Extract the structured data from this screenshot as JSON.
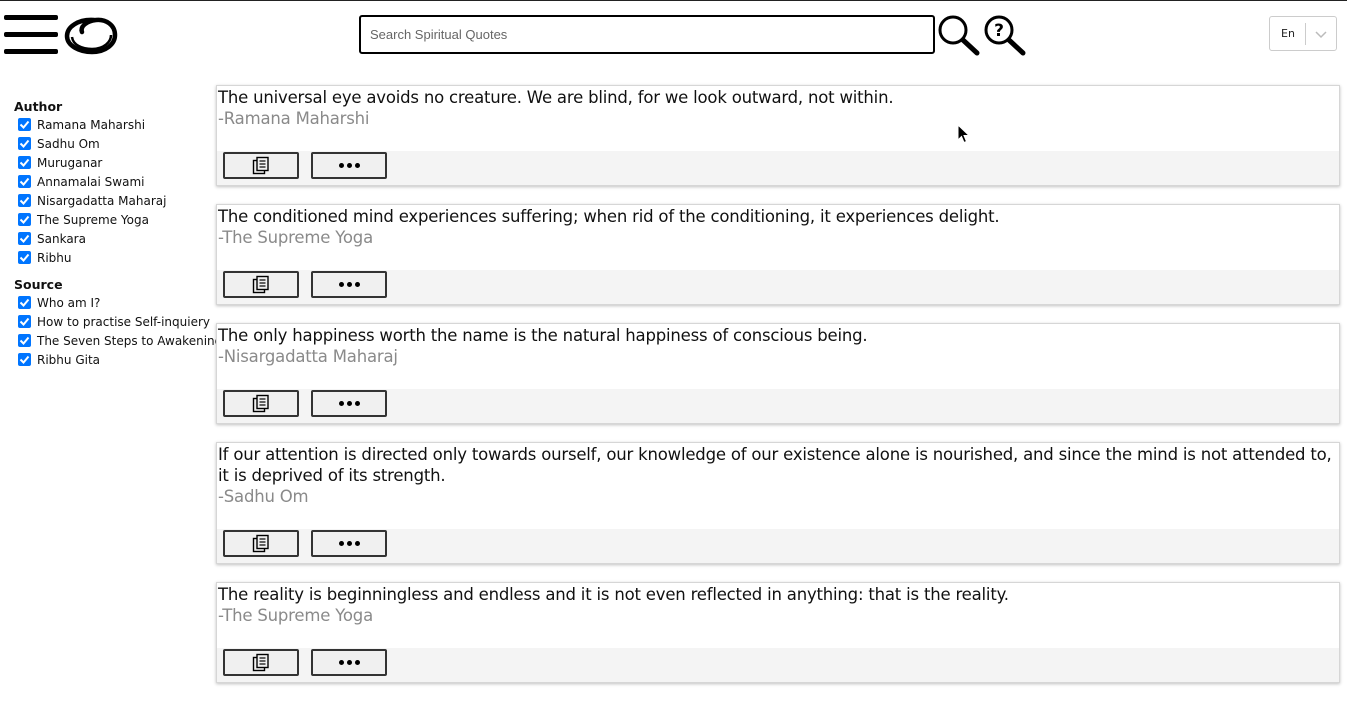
{
  "header": {
    "menu_icon": "hamburger-menu-icon",
    "logo_icon": "enso-circle-logo-icon",
    "search": {
      "placeholder": "Search Spiritual Quotes",
      "value": ""
    },
    "search_icon": "magnifier-icon",
    "help_icon": "question-magnifier-icon",
    "language": {
      "selected": "En",
      "icon": "chevron-down-icon"
    }
  },
  "sidebar": {
    "author_heading": "Author",
    "authors": [
      {
        "label": "Ramana Maharshi",
        "checked": true
      },
      {
        "label": "Sadhu Om",
        "checked": true
      },
      {
        "label": "Muruganar",
        "checked": true
      },
      {
        "label": "Annamalai Swami",
        "checked": true
      },
      {
        "label": "Nisargadatta Maharaj",
        "checked": true
      },
      {
        "label": "The Supreme Yoga",
        "checked": true
      },
      {
        "label": "Sankara",
        "checked": true
      },
      {
        "label": "Ribhu",
        "checked": true
      }
    ],
    "source_heading": "Source",
    "sources": [
      {
        "label": "Who am I?",
        "checked": true
      },
      {
        "label": "How to practise Self-inquiery",
        "checked": true
      },
      {
        "label": "The Seven Steps to Awakening",
        "checked": true
      },
      {
        "label": "Ribhu Gita",
        "checked": true
      }
    ],
    "checkbox_color": "#0075ff"
  },
  "quotes": [
    {
      "text": "The universal eye avoids no creature. We are blind, for we look outward, not within.",
      "author": "-Ramana Maharshi"
    },
    {
      "text": "The conditioned mind experiences suffering; when rid of the conditioning, it experiences delight.",
      "author": "-The Supreme Yoga"
    },
    {
      "text": "The only happiness worth the name is the natural happiness of conscious being.",
      "author": "-Nisargadatta Maharaj"
    },
    {
      "text": "If our attention is directed only towards ourself, our knowledge of our existence alone is nourished, and since the mind is not attended to, it is deprived of its strength.",
      "author": "-Sadhu Om"
    },
    {
      "text": "The reality is beginningless and endless and it is not even reflected in anything: that is the reality.",
      "author": "-The Supreme Yoga"
    }
  ],
  "card_actions": {
    "copy_icon": "copy-icon",
    "more_icon": "more-dots-icon"
  },
  "colors": {
    "author_text": "#8a8a8a",
    "actions_bar": "#f4f4f4"
  }
}
